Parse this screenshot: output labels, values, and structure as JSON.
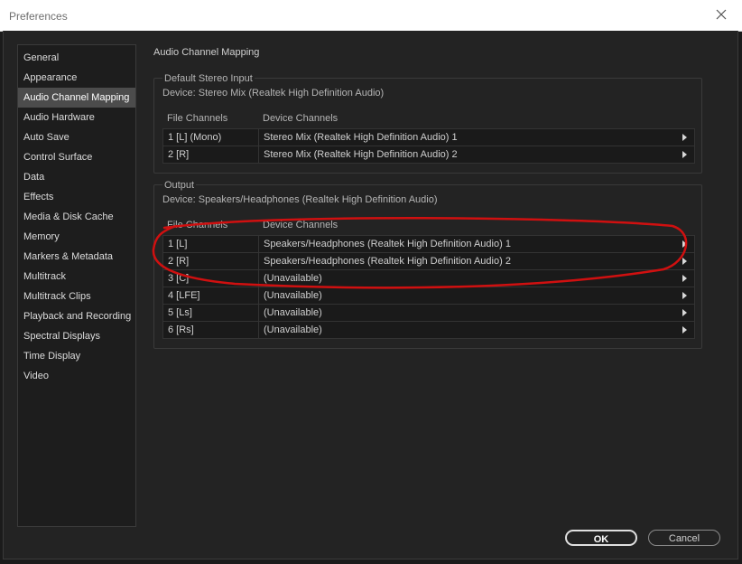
{
  "window": {
    "title": "Preferences"
  },
  "sidebar": {
    "items": [
      {
        "label": "General",
        "selected": false
      },
      {
        "label": "Appearance",
        "selected": false
      },
      {
        "label": "Audio Channel Mapping",
        "selected": true
      },
      {
        "label": "Audio Hardware",
        "selected": false
      },
      {
        "label": "Auto Save",
        "selected": false
      },
      {
        "label": "Control Surface",
        "selected": false
      },
      {
        "label": "Data",
        "selected": false
      },
      {
        "label": "Effects",
        "selected": false
      },
      {
        "label": "Media & Disk Cache",
        "selected": false
      },
      {
        "label": "Memory",
        "selected": false
      },
      {
        "label": "Markers & Metadata",
        "selected": false
      },
      {
        "label": "Multitrack",
        "selected": false
      },
      {
        "label": "Multitrack Clips",
        "selected": false
      },
      {
        "label": "Playback and Recording",
        "selected": false
      },
      {
        "label": "Spectral Displays",
        "selected": false
      },
      {
        "label": "Time Display",
        "selected": false
      },
      {
        "label": "Video",
        "selected": false
      }
    ]
  },
  "main": {
    "heading": "Audio Channel Mapping",
    "input": {
      "title": "Default Stereo Input",
      "device": "Device: Stereo Mix (Realtek High Definition Audio)",
      "col_file": "File Channels",
      "col_device": "Device Channels",
      "rows": [
        {
          "file": "1 [L] (Mono)",
          "device": "Stereo Mix (Realtek High Definition Audio) 1"
        },
        {
          "file": "2 [R]",
          "device": "Stereo Mix (Realtek High Definition Audio) 2"
        }
      ]
    },
    "output": {
      "title": "Output",
      "device": "Device: Speakers/Headphones (Realtek High Definition Audio)",
      "col_file": "File Channels",
      "col_device": "Device Channels",
      "rows": [
        {
          "file": "1 [L]",
          "device": "Speakers/Headphones (Realtek High Definition Audio) 1"
        },
        {
          "file": "2 [R]",
          "device": "Speakers/Headphones (Realtek High Definition Audio) 2"
        },
        {
          "file": "3 [C]",
          "device": "(Unavailable)"
        },
        {
          "file": "4 [LFE]",
          "device": "(Unavailable)"
        },
        {
          "file": "5 [Ls]",
          "device": "(Unavailable)"
        },
        {
          "file": "6 [Rs]",
          "device": "(Unavailable)"
        }
      ]
    }
  },
  "buttons": {
    "ok": "OK",
    "cancel": "Cancel"
  },
  "icons": {
    "close": "close-icon",
    "expand": "chevron-right-icon"
  },
  "colors": {
    "annotation": "#d01010",
    "selected_bg": "#4c4c4c"
  }
}
